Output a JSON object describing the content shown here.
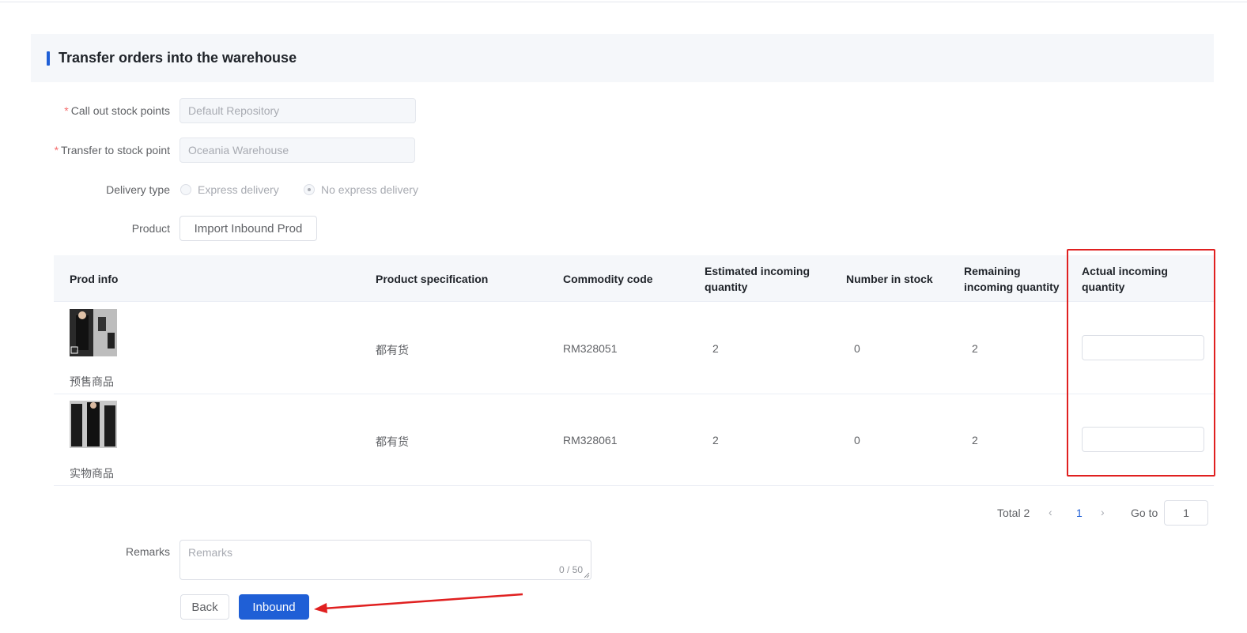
{
  "section": {
    "title": "Transfer orders into the warehouse"
  },
  "form": {
    "call_out_label": "Call out stock points",
    "call_out_value": "Default Repository",
    "transfer_to_label": "Transfer to stock point",
    "transfer_to_value": "Oceania Warehouse",
    "delivery_type_label": "Delivery type",
    "delivery_options": [
      "Express delivery",
      "No express delivery"
    ],
    "delivery_selected": "No express delivery",
    "product_label": "Product",
    "import_button": "Import Inbound Prod",
    "required_mark": "*"
  },
  "table": {
    "headers": {
      "prod_info": "Prod info",
      "spec": "Product specification",
      "code": "Commodity code",
      "estimated_l1": "Estimated incoming",
      "estimated_l2": "quantity",
      "stock": "Number in stock",
      "remaining_l1": "Remaining",
      "remaining_l2": "incoming quantity",
      "actual_l1": "Actual incoming",
      "actual_l2": "quantity"
    },
    "rows": [
      {
        "name": "预售商品",
        "spec": "都有货",
        "code": "RM328051",
        "estimated": "2",
        "stock": "0",
        "remaining": "2",
        "actual": ""
      },
      {
        "name": "实物商品",
        "spec": "都有货",
        "code": "RM328061",
        "estimated": "2",
        "stock": "0",
        "remaining": "2",
        "actual": ""
      }
    ]
  },
  "pagination": {
    "total": "Total 2",
    "current": "1",
    "goto_label": "Go to",
    "goto_value": "1",
    "prev_icon": "‹",
    "next_icon": "›"
  },
  "remarks": {
    "label": "Remarks",
    "placeholder": "Remarks",
    "count": "0 / 50"
  },
  "actions": {
    "back": "Back",
    "inbound": "Inbound"
  },
  "colors": {
    "primary": "#1f5fd6",
    "annotation": "#e02020"
  }
}
